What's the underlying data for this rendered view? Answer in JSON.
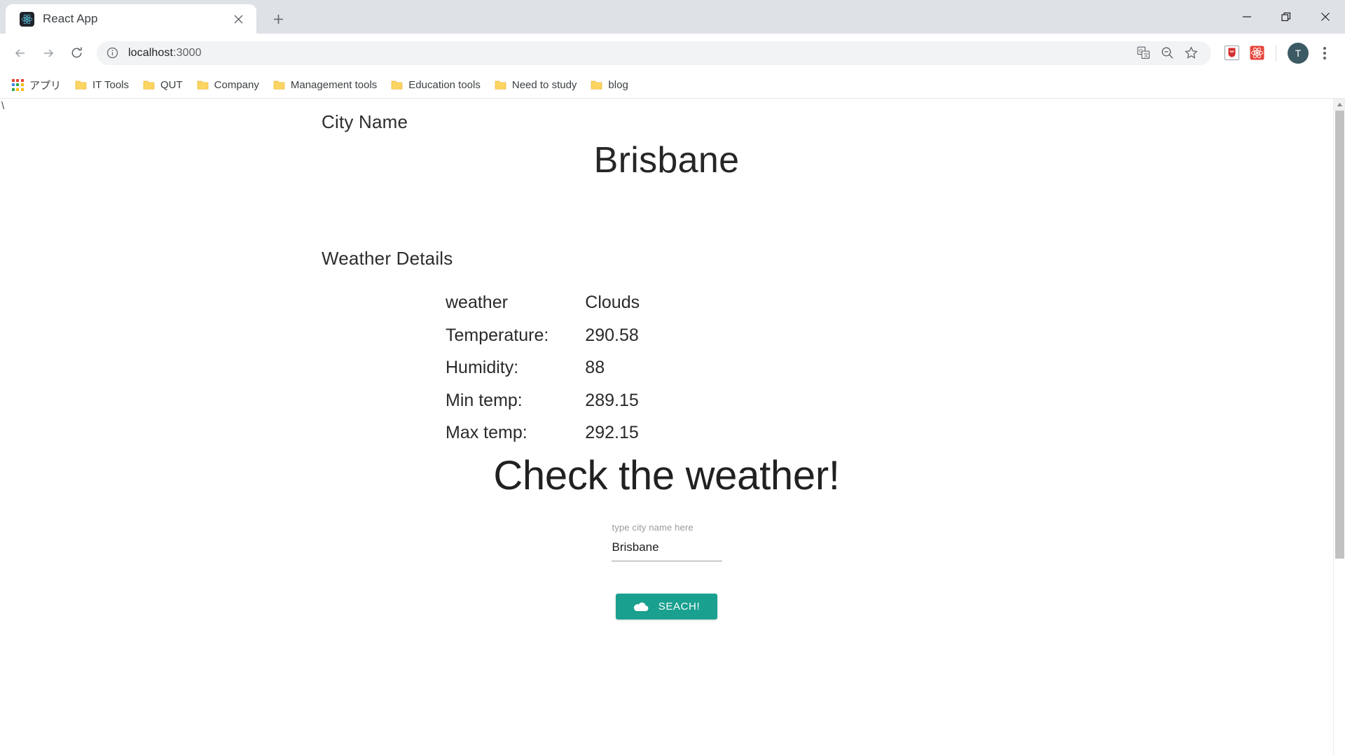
{
  "browser": {
    "tab": {
      "title": "React App",
      "favicon": "react-logo-icon",
      "close": "×"
    },
    "new_tab": "+",
    "window_controls": {
      "minimize": "–",
      "maximize": "❐",
      "close": "✕"
    },
    "nav": {
      "back": "back-arrow-icon",
      "forward": "forward-arrow-icon",
      "reload": "reload-icon"
    },
    "omnibox": {
      "info_icon": "site-info-icon",
      "url_host": "localhost",
      "url_port": ":3000",
      "actions": [
        "translate-icon",
        "zoom-out-icon",
        "bookmark-star-icon"
      ]
    },
    "extensions": [
      "shield-extension-icon",
      "react-devtools-extension-icon"
    ],
    "profile": {
      "initial": "T"
    },
    "menu": "three-dot-menu-icon",
    "bookmarks": [
      {
        "label": "アプリ",
        "icon": "apps-grid-icon"
      },
      {
        "label": "IT Tools",
        "icon": "folder-icon"
      },
      {
        "label": "QUT",
        "icon": "folder-icon"
      },
      {
        "label": "Company",
        "icon": "folder-icon"
      },
      {
        "label": "Management tools",
        "icon": "folder-icon"
      },
      {
        "label": "Education tools",
        "icon": "folder-icon"
      },
      {
        "label": "Need to study",
        "icon": "folder-icon"
      },
      {
        "label": "blog",
        "icon": "folder-icon"
      }
    ]
  },
  "page": {
    "stray_text": "\\",
    "city_label": "City Name",
    "city_name": "Brisbane",
    "details_label": "Weather Details",
    "details": [
      {
        "key": "weather",
        "value": "Clouds"
      },
      {
        "key": "Temperature:",
        "value": "290.58"
      },
      {
        "key": "Humidity:",
        "value": "88"
      },
      {
        "key": "Min temp:",
        "value": "289.15"
      },
      {
        "key": "Max temp:",
        "value": "292.15"
      }
    ],
    "check_title": "Check the weather!",
    "form": {
      "field_label": "type city name here",
      "field_value": "Brisbane",
      "field_placeholder": "type city name here",
      "button_label": "SEACH!",
      "button_icon": "cloud-icon",
      "button_color": "#1aa08f"
    }
  }
}
